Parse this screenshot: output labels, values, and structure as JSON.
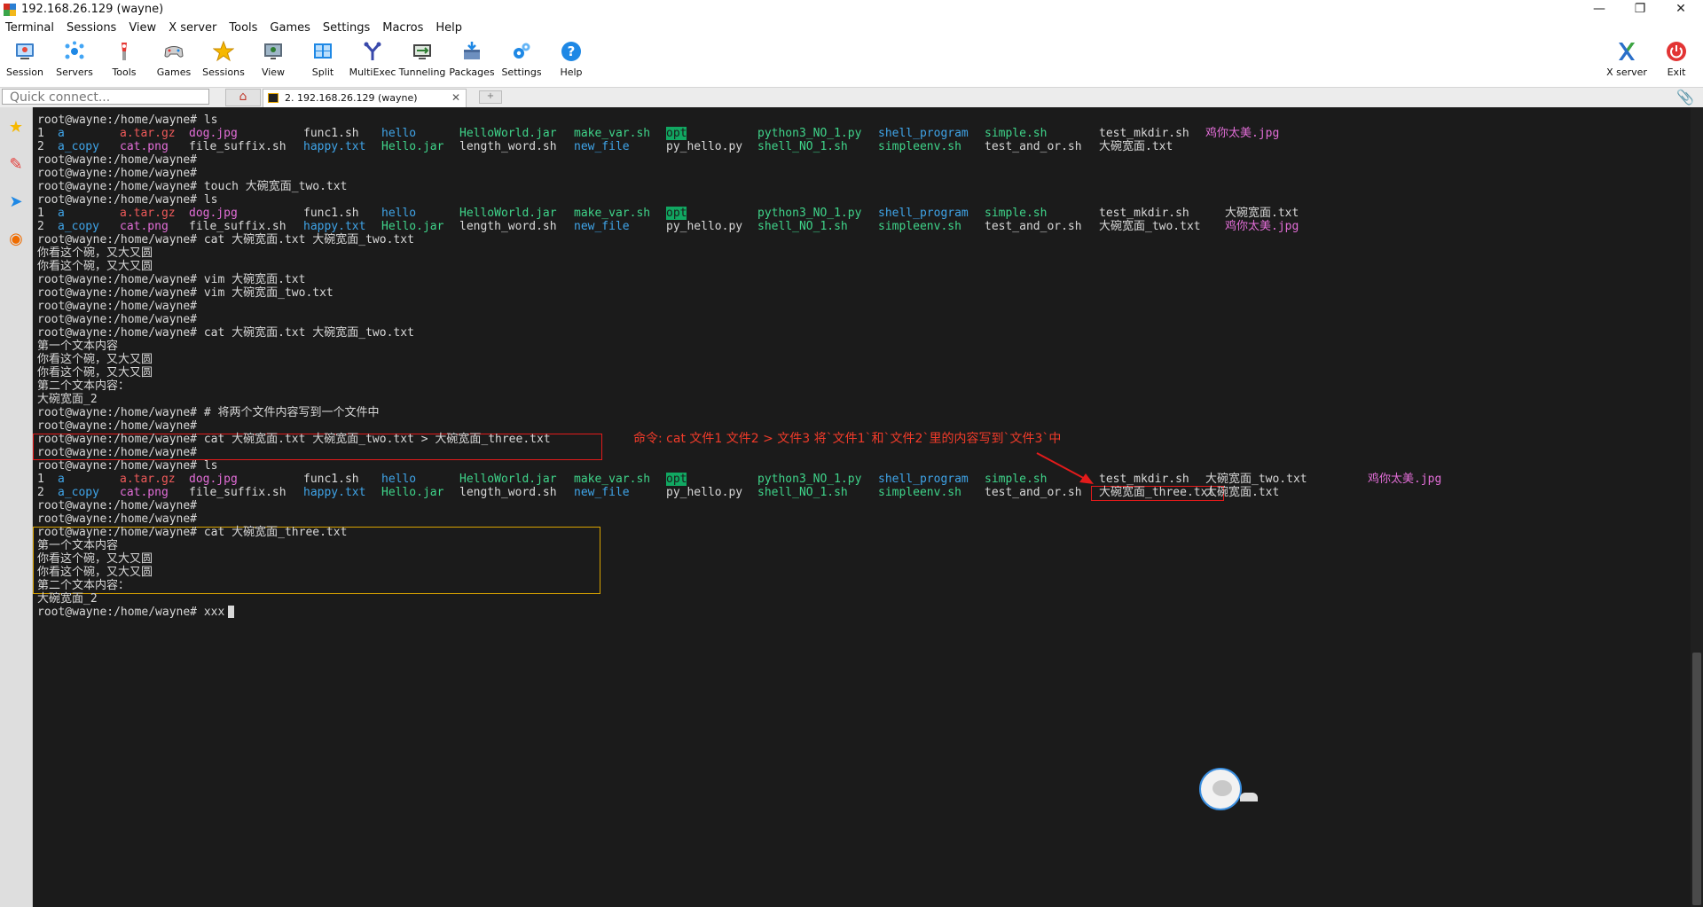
{
  "window": {
    "title": "192.168.26.129 (wayne)",
    "controls": {
      "minimize": "—",
      "restore": "❐",
      "close": "✕"
    }
  },
  "menu": [
    "Terminal",
    "Sessions",
    "View",
    "X server",
    "Tools",
    "Games",
    "Settings",
    "Macros",
    "Help"
  ],
  "toolbar": {
    "items": [
      {
        "label": "Session",
        "icon": "session-icon"
      },
      {
        "label": "Servers",
        "icon": "servers-icon"
      },
      {
        "label": "Tools",
        "icon": "tools-icon"
      },
      {
        "label": "Games",
        "icon": "games-icon"
      },
      {
        "label": "Sessions",
        "icon": "star-icon"
      },
      {
        "label": "View",
        "icon": "view-icon"
      },
      {
        "label": "Split",
        "icon": "split-icon"
      },
      {
        "label": "MultiExec",
        "icon": "multiexec-icon"
      },
      {
        "label": "Tunneling",
        "icon": "tunneling-icon"
      },
      {
        "label": "Packages",
        "icon": "packages-icon"
      },
      {
        "label": "Settings",
        "icon": "gears-icon"
      },
      {
        "label": "Help",
        "icon": "help-icon"
      }
    ],
    "right": [
      {
        "label": "X server",
        "icon": "x-server-icon"
      },
      {
        "label": "Exit",
        "icon": "power-icon"
      }
    ],
    "help_glyph": "?"
  },
  "tabs": {
    "quick_connect_placeholder": "Quick connect...",
    "home_glyph": "⌂",
    "session_tab_label": "2. 192.168.26.129 (wayne)",
    "close_glyph": "✕",
    "new_tab_glyph": "+",
    "attach_glyph": "📎"
  },
  "sidebar": {
    "buttons": [
      {
        "name": "favorites-star-icon",
        "glyph": "★"
      },
      {
        "name": "tools-sidebar-icon",
        "glyph": "✎"
      },
      {
        "name": "send-sidebar-icon",
        "glyph": "➤"
      },
      {
        "name": "macros-sidebar-icon",
        "glyph": "◉"
      }
    ]
  },
  "terminal": {
    "lines": [
      [
        [
          "root@wayne:/home/wayne# ls",
          "w"
        ]
      ],
      [
        [
          "1",
          "w"
        ],
        [
          "a",
          "b"
        ],
        [
          "a.tar.gz",
          "r"
        ],
        [
          "dog.jpg",
          "m"
        ],
        [
          "func1.sh",
          "w"
        ],
        [
          "hello",
          "b"
        ],
        [
          "HelloWorld.jar",
          "g"
        ],
        [
          "make_var.sh",
          "g"
        ],
        [
          "opt",
          "hl"
        ],
        [
          "python3_NO_1.py",
          "g"
        ],
        [
          "shell_program",
          "b"
        ],
        [
          "simple.sh",
          "g"
        ],
        [
          "test_mkdir.sh",
          "w"
        ],
        [
          "鸡你太美.jpg",
          "m"
        ]
      ],
      [
        [
          "2",
          "w"
        ],
        [
          "a_copy",
          "b"
        ],
        [
          "cat.png",
          "m"
        ],
        [
          "file_suffix.sh",
          "w"
        ],
        [
          "happy.txt",
          "b"
        ],
        [
          "Hello.jar",
          "g"
        ],
        [
          "length_word.sh",
          "w"
        ],
        [
          "new_file",
          "b"
        ],
        [
          "py_hello.py",
          "w"
        ],
        [
          "shell_NO_1.sh",
          "g"
        ],
        [
          "simpleenv.sh",
          "g"
        ],
        [
          "test_and_or.sh",
          "w"
        ],
        [
          "大碗宽面.txt",
          "w"
        ]
      ],
      [
        [
          "root@wayne:/home/wayne#",
          "w"
        ]
      ],
      [
        [
          "root@wayne:/home/wayne#",
          "w"
        ]
      ],
      [
        [
          "root@wayne:/home/wayne# touch 大碗宽面_two.txt",
          "w"
        ]
      ],
      [
        [
          "root@wayne:/home/wayne# ls",
          "w"
        ]
      ],
      [
        [
          "1",
          "w"
        ],
        [
          "a",
          "b"
        ],
        [
          "a.tar.gz",
          "r"
        ],
        [
          "dog.jpg",
          "m"
        ],
        [
          "func1.sh",
          "w"
        ],
        [
          "hello",
          "b"
        ],
        [
          "HelloWorld.jar",
          "g"
        ],
        [
          "make_var.sh",
          "g"
        ],
        [
          "opt",
          "hl"
        ],
        [
          "python3_NO_1.py",
          "g"
        ],
        [
          "shell_program",
          "b"
        ],
        [
          "simple.sh",
          "g"
        ],
        [
          "test_mkdir.sh",
          "w"
        ],
        [
          "大碗宽面.txt",
          "w"
        ]
      ],
      [
        [
          "2",
          "w"
        ],
        [
          "a_copy",
          "b"
        ],
        [
          "cat.png",
          "m"
        ],
        [
          "file_suffix.sh",
          "w"
        ],
        [
          "happy.txt",
          "b"
        ],
        [
          "Hello.jar",
          "g"
        ],
        [
          "length_word.sh",
          "w"
        ],
        [
          "new_file",
          "b"
        ],
        [
          "py_hello.py",
          "w"
        ],
        [
          "shell_NO_1.sh",
          "g"
        ],
        [
          "simpleenv.sh",
          "g"
        ],
        [
          "test_and_or.sh",
          "w"
        ],
        [
          "大碗宽面_two.txt",
          "w"
        ],
        [
          "鸡你太美.jpg",
          "m"
        ]
      ],
      [
        [
          "root@wayne:/home/wayne# cat 大碗宽面.txt 大碗宽面_two.txt",
          "w"
        ]
      ],
      [
        [
          "你看这个碗，又大又圆",
          "w"
        ]
      ],
      [
        [
          "你看这个碗，又大又圆",
          "w"
        ]
      ],
      [
        [
          "root@wayne:/home/wayne# vim 大碗宽面.txt",
          "w"
        ]
      ],
      [
        [
          "root@wayne:/home/wayne# vim 大碗宽面_two.txt",
          "w"
        ]
      ],
      [
        [
          "root@wayne:/home/wayne#",
          "w"
        ]
      ],
      [
        [
          "root@wayne:/home/wayne#",
          "w"
        ]
      ],
      [
        [
          "root@wayne:/home/wayne# cat 大碗宽面.txt 大碗宽面_two.txt",
          "w"
        ]
      ],
      [
        [
          "第一个文本内容",
          "w"
        ]
      ],
      [
        [
          "你看这个碗，又大又圆",
          "w"
        ]
      ],
      [
        [
          "你看这个碗，又大又圆",
          "w"
        ]
      ],
      [
        [
          "第二个文本内容：",
          "w"
        ]
      ],
      [
        [
          "大碗宽面_2",
          "w"
        ]
      ],
      [
        [
          "root@wayne:/home/wayne# # 将两个文件内容写到一个文件中",
          "w"
        ]
      ],
      [
        [
          "root@wayne:/home/wayne#",
          "w"
        ]
      ],
      [
        [
          "root@wayne:/home/wayne# cat 大碗宽面.txt 大碗宽面_two.txt > 大碗宽面_three.txt",
          "w"
        ]
      ],
      [
        [
          "root@wayne:/home/wayne#",
          "w"
        ]
      ],
      [
        [
          "root@wayne:/home/wayne# ls",
          "w"
        ]
      ],
      [
        [
          "1",
          "w"
        ],
        [
          "a",
          "b"
        ],
        [
          "a.tar.gz",
          "r"
        ],
        [
          "dog.jpg",
          "m"
        ],
        [
          "func1.sh",
          "w"
        ],
        [
          "hello",
          "b"
        ],
        [
          "HelloWorld.jar",
          "g"
        ],
        [
          "make_var.sh",
          "g"
        ],
        [
          "opt",
          "hl"
        ],
        [
          "python3_NO_1.py",
          "g"
        ],
        [
          "shell_program",
          "b"
        ],
        [
          "simple.sh",
          "g"
        ],
        [
          "test_mkdir.sh",
          "w"
        ],
        [
          "大碗宽面_two.txt",
          "w"
        ],
        [
          "鸡你太美.jpg",
          "m"
        ]
      ],
      [
        [
          "2",
          "w"
        ],
        [
          "a_copy",
          "b"
        ],
        [
          "cat.png",
          "m"
        ],
        [
          "file_suffix.sh",
          "w"
        ],
        [
          "happy.txt",
          "b"
        ],
        [
          "Hello.jar",
          "g"
        ],
        [
          "length_word.sh",
          "w"
        ],
        [
          "new_file",
          "b"
        ],
        [
          "py_hello.py",
          "w"
        ],
        [
          "shell_NO_1.sh",
          "g"
        ],
        [
          "simpleenv.sh",
          "g"
        ],
        [
          "test_and_or.sh",
          "w"
        ],
        [
          "大碗宽面_three.txt",
          "w"
        ],
        [
          "大碗宽面.txt",
          "w"
        ]
      ],
      [
        [
          "root@wayne:/home/wayne#",
          "w"
        ]
      ],
      [
        [
          "root@wayne:/home/wayne#",
          "w"
        ]
      ],
      [
        [
          "root@wayne:/home/wayne# cat 大碗宽面_three.txt",
          "w"
        ]
      ],
      [
        [
          "第一个文本内容",
          "w"
        ]
      ],
      [
        [
          "你看这个碗，又大又圆",
          "w"
        ]
      ],
      [
        [
          "你看这个碗，又大又圆",
          "w"
        ]
      ],
      [
        [
          "第二个文本内容：",
          "w"
        ]
      ],
      [
        [
          "大碗宽面_2",
          "w"
        ]
      ],
      [
        [
          "root@wayne:/home/wayne# xxx",
          "w"
        ]
      ]
    ],
    "annotation_text": "命令: cat 文件1 文件2 > 文件3   将`文件1`和`文件2`里的内容写到`文件3`中"
  },
  "colors": {
    "terminal_bg": "#1b1b1b",
    "text": "#d8d8d8",
    "dir_blue": "#3fa4e8",
    "image_magenta": "#e36ed8",
    "archive_red": "#ef5a5a",
    "exec_green": "#3fd48a",
    "highlight_green": "#11a862",
    "annotation_red": "#e21b1b",
    "annotation_yellow": "#d9a300"
  }
}
